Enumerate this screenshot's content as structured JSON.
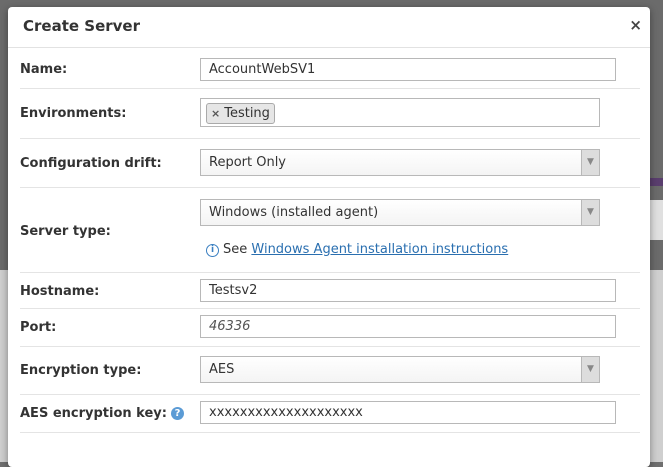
{
  "dialog": {
    "title": "Create Server",
    "close_glyph": "×"
  },
  "form": {
    "name": {
      "label": "Name:",
      "value": "AccountWebSV1"
    },
    "environments": {
      "label": "Environments:",
      "tags": [
        "Testing"
      ],
      "tag_remove_glyph": "×"
    },
    "configuration_drift": {
      "label": "Configuration drift:",
      "selected": "Report Only"
    },
    "server_type": {
      "label": "Server type:",
      "selected": "Windows (installed agent)",
      "help_prefix": "See",
      "help_link": "Windows Agent installation instructions",
      "help_icon": "info-icon"
    },
    "hostname": {
      "label": "Hostname:",
      "value": "Testsv2"
    },
    "port": {
      "label": "Port:",
      "placeholder": "46336"
    },
    "encryption_type": {
      "label": "Encryption type:",
      "selected": "AES"
    },
    "aes_key": {
      "label": "AES encryption key:",
      "value": "xxxxxxxxxxxxxxxxxxxx",
      "help_icon": "question-icon"
    }
  },
  "colors": {
    "link": "#2a6fb0",
    "help_icon": "#5b9bd5"
  }
}
